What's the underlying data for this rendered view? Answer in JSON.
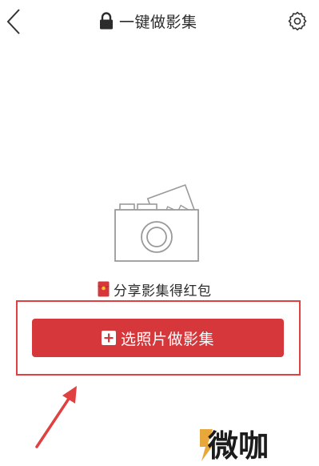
{
  "header": {
    "title": "一键做影集",
    "back_icon": "chevron-left-icon",
    "lock_icon": "lock-icon",
    "settings_icon": "gear-icon"
  },
  "main": {
    "illustration_icon": "camera-icon",
    "share_icon": "red-envelope-icon",
    "share_label": "分享影集得红包",
    "primary_button": {
      "label": "选照片做影集",
      "icon": "plus-icon"
    }
  },
  "annotations": {
    "highlight_color": "#e04040",
    "arrow_color": "#e04040"
  },
  "watermark": {
    "text": "微咖",
    "accent_color": "#e8a73a"
  },
  "colors": {
    "accent": "#d6373b",
    "text": "#2b2b2b",
    "background": "#ffffff"
  }
}
